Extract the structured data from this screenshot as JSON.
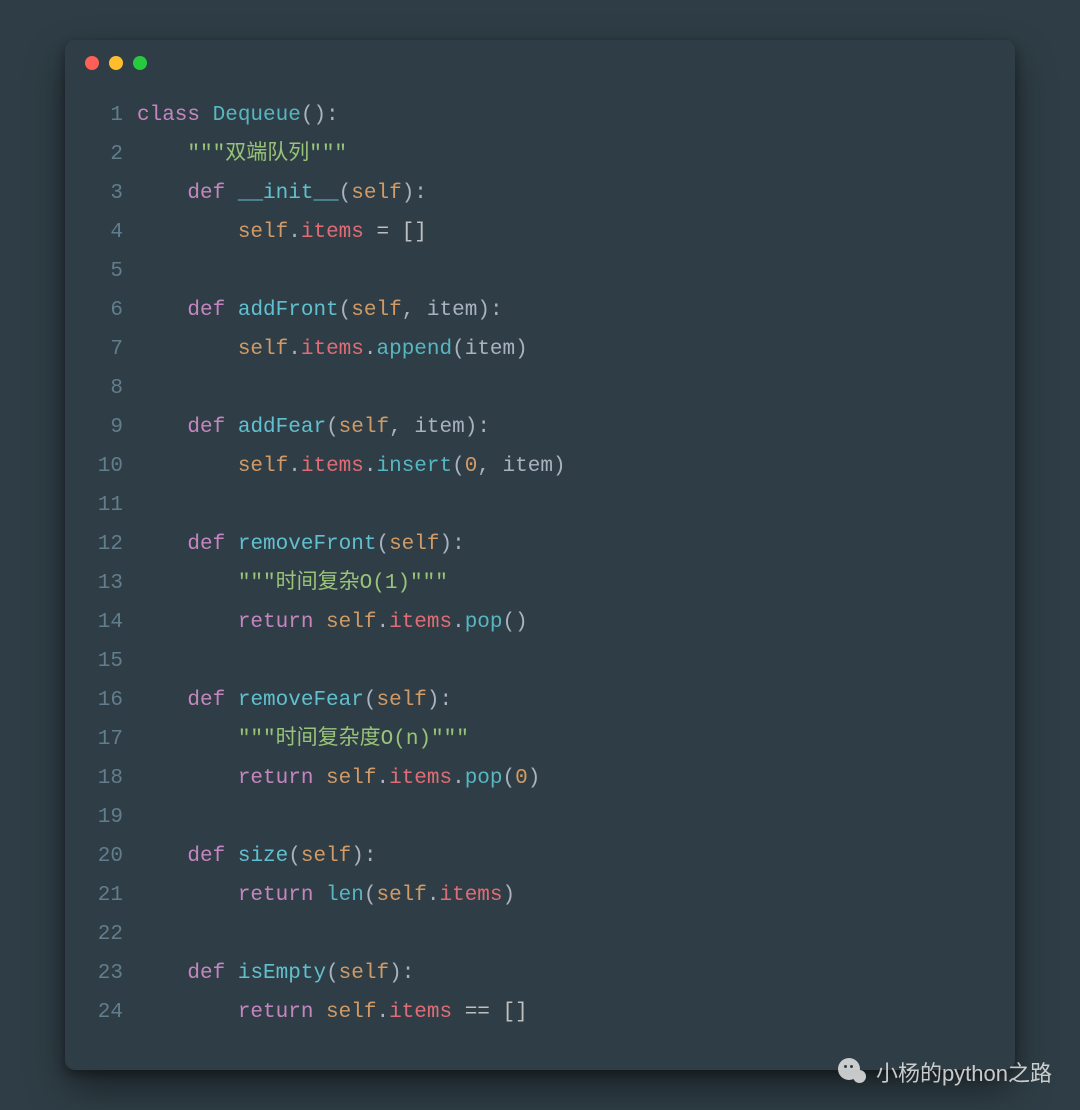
{
  "watermark": {
    "text": "小杨的python之路"
  },
  "code": {
    "language": "python",
    "lines": [
      {
        "n": 1,
        "tokens": [
          [
            "keyword",
            "class "
          ],
          [
            "classname",
            "Dequeue"
          ],
          [
            "punct",
            "():"
          ]
        ]
      },
      {
        "n": 2,
        "tokens": [
          [
            "default",
            "    "
          ],
          [
            "string",
            "\"\"\"双端队列\"\"\""
          ]
        ]
      },
      {
        "n": 3,
        "tokens": [
          [
            "default",
            "    "
          ],
          [
            "keyword",
            "def "
          ],
          [
            "funcname",
            "__init__"
          ],
          [
            "punct",
            "("
          ],
          [
            "self",
            "self"
          ],
          [
            "punct",
            "):"
          ]
        ]
      },
      {
        "n": 4,
        "tokens": [
          [
            "default",
            "        "
          ],
          [
            "self",
            "self"
          ],
          [
            "punct",
            "."
          ],
          [
            "attr",
            "items"
          ],
          [
            "default",
            " = []"
          ]
        ]
      },
      {
        "n": 5,
        "tokens": []
      },
      {
        "n": 6,
        "tokens": [
          [
            "default",
            "    "
          ],
          [
            "keyword",
            "def "
          ],
          [
            "funcname",
            "addFront"
          ],
          [
            "punct",
            "("
          ],
          [
            "self",
            "self"
          ],
          [
            "punct",
            ", "
          ],
          [
            "param",
            "item"
          ],
          [
            "punct",
            "):"
          ]
        ]
      },
      {
        "n": 7,
        "tokens": [
          [
            "default",
            "        "
          ],
          [
            "self",
            "self"
          ],
          [
            "punct",
            "."
          ],
          [
            "attr",
            "items"
          ],
          [
            "punct",
            "."
          ],
          [
            "call",
            "append"
          ],
          [
            "punct",
            "("
          ],
          [
            "param",
            "item"
          ],
          [
            "punct",
            ")"
          ]
        ]
      },
      {
        "n": 8,
        "tokens": []
      },
      {
        "n": 9,
        "tokens": [
          [
            "default",
            "    "
          ],
          [
            "keyword",
            "def "
          ],
          [
            "funcname",
            "addFear"
          ],
          [
            "punct",
            "("
          ],
          [
            "self",
            "self"
          ],
          [
            "punct",
            ", "
          ],
          [
            "param",
            "item"
          ],
          [
            "punct",
            "):"
          ]
        ]
      },
      {
        "n": 10,
        "tokens": [
          [
            "default",
            "        "
          ],
          [
            "self",
            "self"
          ],
          [
            "punct",
            "."
          ],
          [
            "attr",
            "items"
          ],
          [
            "punct",
            "."
          ],
          [
            "call",
            "insert"
          ],
          [
            "punct",
            "("
          ],
          [
            "number",
            "0"
          ],
          [
            "punct",
            ", "
          ],
          [
            "param",
            "item"
          ],
          [
            "punct",
            ")"
          ]
        ]
      },
      {
        "n": 11,
        "tokens": []
      },
      {
        "n": 12,
        "tokens": [
          [
            "default",
            "    "
          ],
          [
            "keyword",
            "def "
          ],
          [
            "funcname",
            "removeFront"
          ],
          [
            "punct",
            "("
          ],
          [
            "self",
            "self"
          ],
          [
            "punct",
            "):"
          ]
        ]
      },
      {
        "n": 13,
        "tokens": [
          [
            "default",
            "        "
          ],
          [
            "string",
            "\"\"\"时间复杂O(1)\"\"\""
          ]
        ]
      },
      {
        "n": 14,
        "tokens": [
          [
            "default",
            "        "
          ],
          [
            "keyword",
            "return "
          ],
          [
            "self",
            "self"
          ],
          [
            "punct",
            "."
          ],
          [
            "attr",
            "items"
          ],
          [
            "punct",
            "."
          ],
          [
            "call",
            "pop"
          ],
          [
            "punct",
            "()"
          ]
        ]
      },
      {
        "n": 15,
        "tokens": []
      },
      {
        "n": 16,
        "tokens": [
          [
            "default",
            "    "
          ],
          [
            "keyword",
            "def "
          ],
          [
            "funcname",
            "removeFear"
          ],
          [
            "punct",
            "("
          ],
          [
            "self",
            "self"
          ],
          [
            "punct",
            "):"
          ]
        ]
      },
      {
        "n": 17,
        "tokens": [
          [
            "default",
            "        "
          ],
          [
            "string",
            "\"\"\"时间复杂度O(n)\"\"\""
          ]
        ]
      },
      {
        "n": 18,
        "tokens": [
          [
            "default",
            "        "
          ],
          [
            "keyword",
            "return "
          ],
          [
            "self",
            "self"
          ],
          [
            "punct",
            "."
          ],
          [
            "attr",
            "items"
          ],
          [
            "punct",
            "."
          ],
          [
            "call",
            "pop"
          ],
          [
            "punct",
            "("
          ],
          [
            "number",
            "0"
          ],
          [
            "punct",
            ")"
          ]
        ]
      },
      {
        "n": 19,
        "tokens": []
      },
      {
        "n": 20,
        "tokens": [
          [
            "default",
            "    "
          ],
          [
            "keyword",
            "def "
          ],
          [
            "funcname",
            "size"
          ],
          [
            "punct",
            "("
          ],
          [
            "self",
            "self"
          ],
          [
            "punct",
            "):"
          ]
        ]
      },
      {
        "n": 21,
        "tokens": [
          [
            "default",
            "        "
          ],
          [
            "keyword",
            "return "
          ],
          [
            "builtin",
            "len"
          ],
          [
            "punct",
            "("
          ],
          [
            "self",
            "self"
          ],
          [
            "punct",
            "."
          ],
          [
            "attr",
            "items"
          ],
          [
            "punct",
            ")"
          ]
        ]
      },
      {
        "n": 22,
        "tokens": []
      },
      {
        "n": 23,
        "tokens": [
          [
            "default",
            "    "
          ],
          [
            "keyword",
            "def "
          ],
          [
            "funcname",
            "isEmpty"
          ],
          [
            "punct",
            "("
          ],
          [
            "self",
            "self"
          ],
          [
            "punct",
            "):"
          ]
        ]
      },
      {
        "n": 24,
        "tokens": [
          [
            "default",
            "        "
          ],
          [
            "keyword",
            "return "
          ],
          [
            "self",
            "self"
          ],
          [
            "punct",
            "."
          ],
          [
            "attr",
            "items"
          ],
          [
            "default",
            " == []"
          ]
        ]
      }
    ]
  }
}
